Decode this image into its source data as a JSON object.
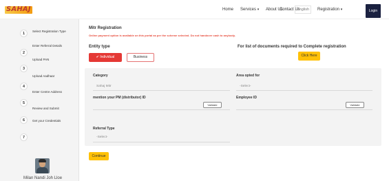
{
  "header": {
    "logo_text": "SAHAJ",
    "nav": {
      "home": "Home",
      "services": "Services",
      "about": "About Us",
      "contact": "Contact Us",
      "language": "English",
      "registration": "Registration",
      "login": "Login"
    },
    "caret": "▾"
  },
  "sidebar": {
    "steps": [
      {
        "num": "1",
        "label": "Select Registration Type"
      },
      {
        "num": "2",
        "label": "Enter Referral Details"
      },
      {
        "num": "",
        "label": "Upload PAN"
      },
      {
        "num": "3",
        "label": ""
      },
      {
        "num": "",
        "label": "Upload Aadhaar"
      },
      {
        "num": "4",
        "label": "Enter Centre Address"
      },
      {
        "num": "5",
        "label": "Review and Submit"
      },
      {
        "num": "6",
        "label": "Get your Credentials"
      },
      {
        "num": "7",
        "label": ""
      }
    ],
    "user_name": "Milan Nandi Joh Lloe"
  },
  "main": {
    "title": "Mitr Registration",
    "warning": "Online payment option is available on this portal as per the scheme selected. Do not handover cash to anybody.",
    "entity_type_title": "Entity type",
    "entity_buttons": {
      "individual": "✔ Individual",
      "business": "Business"
    },
    "docs_title": "For list of documents required to Complete registration",
    "click_here": "Click Here",
    "form": {
      "category_label": "Category",
      "category_value": "Sahaj Mitr",
      "area_label": "Area opted for",
      "area_value": "-Select-",
      "pm_label": "mention your PM (distributor) ID",
      "employee_label": "Employee ID",
      "validate_label": "Validate",
      "referral_label": "Referral Type",
      "referral_value": "-Select-"
    },
    "continue": "Continue"
  },
  "colors": {
    "accent_red": "#e53935",
    "accent_yellow": "#ffc107",
    "navy": "#1a2140"
  }
}
